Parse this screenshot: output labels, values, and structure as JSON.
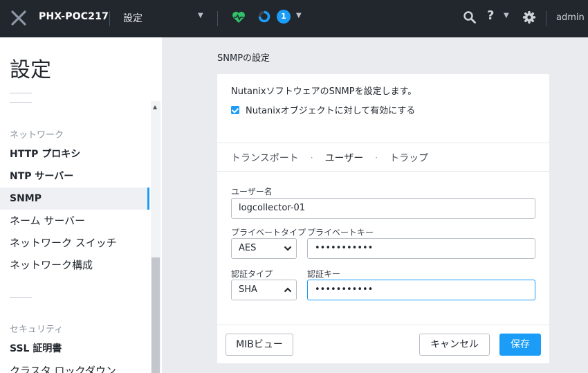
{
  "header": {
    "cluster_name": "PHX-POC217",
    "page_selector": "設定",
    "task_count": "1",
    "user": "admin"
  },
  "sidebar": {
    "title": "設定",
    "groups": [
      {
        "label": "ネットワーク",
        "items": [
          {
            "label": "HTTP プロキシ"
          },
          {
            "label": "NTP サーバー"
          },
          {
            "label": "SNMP"
          },
          {
            "label": "ネーム サーバー"
          },
          {
            "label": "ネットワーク スイッチ"
          },
          {
            "label": "ネットワーク構成"
          }
        ]
      },
      {
        "label": "セキュリティ",
        "items": [
          {
            "label": "SSL 証明書"
          },
          {
            "label": "クラスタ ロックダウン"
          }
        ]
      }
    ],
    "active_item": "SNMP"
  },
  "main": {
    "section_title": "SNMPの設定",
    "description": "NutanixソフトウェアのSNMPを設定します。",
    "enable_checkbox": {
      "label": "Nutanixオブジェクトに対して有効にする",
      "checked": true
    },
    "tabs": [
      {
        "label": "トランスポート"
      },
      {
        "label": "ユーザー"
      },
      {
        "label": "トラップ"
      }
    ],
    "active_tab": "ユーザー",
    "form": {
      "username_label": "ユーザー名",
      "username_value": "logcollector-01",
      "priv_type_label": "プライベートタイプ",
      "priv_type_value": "AES",
      "priv_key_label": "プライベートキー",
      "priv_key_value": "•••••••••••",
      "auth_type_label": "認証タイプ",
      "auth_type_value": "SHA",
      "auth_key_label": "認証キー",
      "auth_key_value": "•••••••••••"
    },
    "buttons": {
      "mib_view": "MIBビュー",
      "cancel": "キャンセル",
      "save": "保存"
    }
  },
  "colors": {
    "topbar": "#22272e",
    "accent": "#1b9cf7",
    "health_green": "#2fc26b"
  }
}
